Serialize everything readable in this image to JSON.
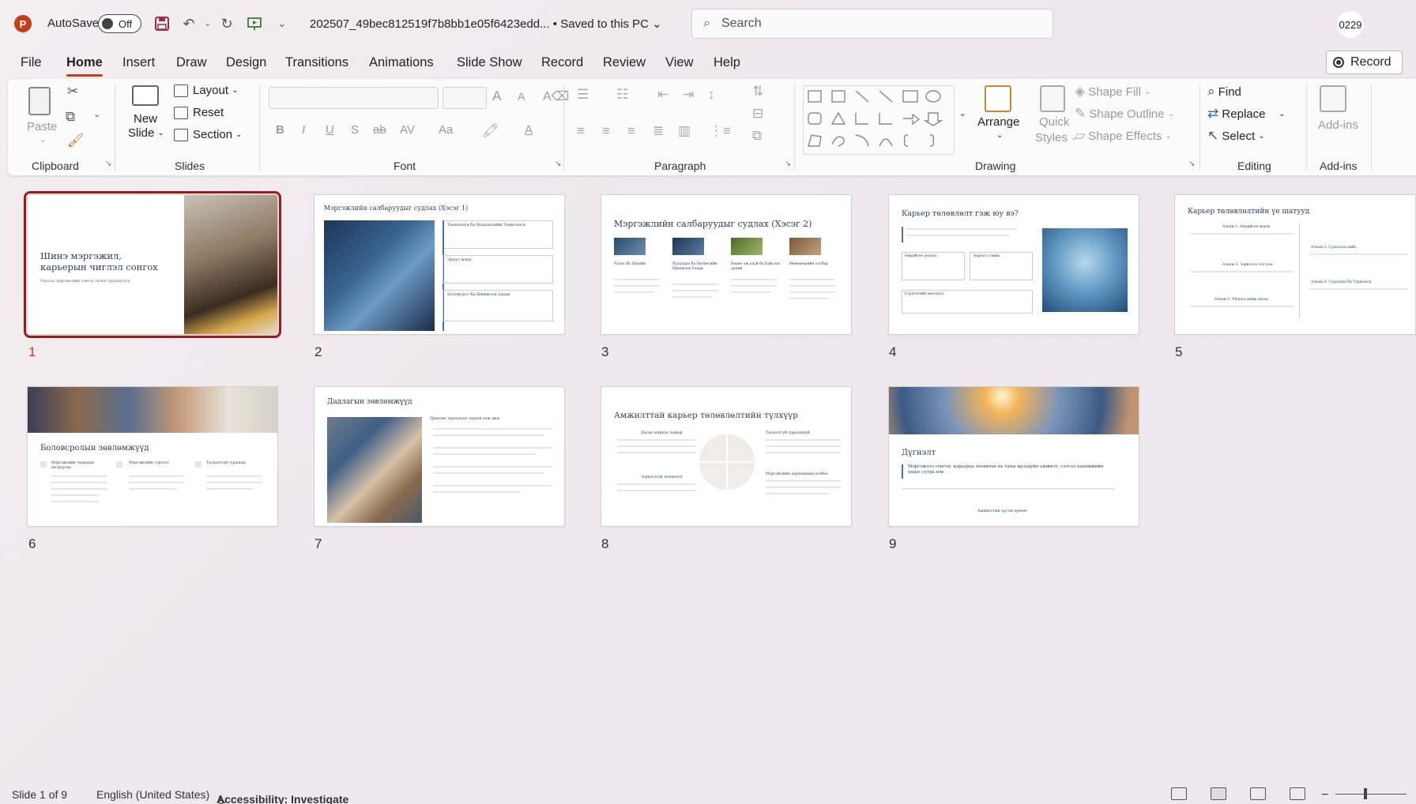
{
  "titlebar": {
    "autosave_label": "AutoSave",
    "autosave_state": "Off",
    "document_title": "202507_49bec812519f7b8bb1e05f6423edd...",
    "save_status": "Saved to this PC",
    "search_placeholder": "Search",
    "user_initials": "0229"
  },
  "menu": {
    "tabs": [
      "File",
      "Home",
      "Insert",
      "Draw",
      "Design",
      "Transitions",
      "Animations",
      "Slide Show",
      "Record",
      "Review",
      "View",
      "Help"
    ],
    "active_tab": "Home",
    "record_button": "Record"
  },
  "ribbon": {
    "clipboard": {
      "label": "Clipboard",
      "paste": "Paste"
    },
    "slides": {
      "label": "Slides",
      "new_slide_line1": "New",
      "new_slide_line2": "Slide",
      "layout": "Layout",
      "reset": "Reset",
      "section": "Section"
    },
    "font": {
      "label": "Font",
      "bold": "B",
      "italic": "I",
      "underline": "U",
      "shadow": "S",
      "strike": "ab",
      "spacing": "AV",
      "case": "Aa",
      "grow": "A",
      "shrink": "A"
    },
    "paragraph": {
      "label": "Paragraph"
    },
    "drawing": {
      "label": "Drawing",
      "arrange": "Arrange",
      "quick_styles_line1": "Quick",
      "quick_styles_line2": "Styles",
      "shape_fill": "Shape Fill",
      "shape_outline": "Shape Outline",
      "shape_effects": "Shape Effects"
    },
    "editing": {
      "label": "Editing",
      "find": "Find",
      "replace": "Replace",
      "select": "Select"
    },
    "addins": {
      "label": "Add-ins",
      "button": "Add-ins"
    }
  },
  "slides": [
    {
      "number": "1",
      "title": "Шинэ мэргэжил, карьерын чиглэл сонгох",
      "subtitle": "Ухаалаг мэргэжлийн сонгох талын туршлагууд"
    },
    {
      "number": "2",
      "title": "Мэргэжлийн салбаруудыг судлах (Хэсэг 1)",
      "items": [
        "Технологи ба Мэдээллийн Технологи",
        "Эрүүл мэнд",
        "Боловсрол ба Шинжлэх ухаан"
      ]
    },
    {
      "number": "3",
      "title": "Мэргэжлийн салбаруудыг судлах (Хэсэг 2)",
      "columns": [
        "Урлаг ба Дизайн",
        "Худалдаа ба Бизнесийн Шинжлэх Ухаан",
        "Хөдөө аж ахуй ба Байгаль орчин",
        "Инженерийн салбар"
      ]
    },
    {
      "number": "4",
      "title": "Карьер төлөвлөлт гэж юу вэ?",
      "boxes": [
        "Өөрийгөө үнэлэх",
        "Зорилго тавих",
        "Стратегийн методол"
      ]
    },
    {
      "number": "5",
      "title": "Карьер төлөвлөлтийн үе шатууд",
      "steps": [
        "Алхам 1: Өөрийгөө мэдэх",
        "Алхам 2: Судалгаа хийх",
        "Алхам 3: Зорилгоо тогтоох",
        "Алхам 4: Суралцах ба Туршлага",
        "Алхам 5: Үйлдэл хийж эхлэх"
      ]
    },
    {
      "number": "6",
      "title": "Боловсролын зөвлөмжүүд",
      "columns": [
        "Мэргэжлийн чадварыг хөгжүүлэх",
        "Мэргэжлийн сургалт",
        "Тасралтгүй суралцах"
      ]
    },
    {
      "number": "7",
      "title": "Дадлагын зөвлөмжүүд",
      "heading": "Практик туршлагыг хэрхэн олж авах"
    },
    {
      "number": "8",
      "title": "Амжилттай карьер төлөвлөлтийн түлхүүр",
      "quadrants": [
        "Дасан зохицох чадвар",
        "Тасралтгүй суралцахуй",
        "Зорилготой төлөвлөлт",
        "Мэргэжлийн харилцааны холбоо"
      ]
    },
    {
      "number": "9",
      "title": "Дүгнэлт",
      "quote": "Мэргэжлээ сонгох, карьераа төлөвлөх нь таны ирээдүйн амжилт, сэтгэл ханамжийн үндэс суурь юм.",
      "footer": "Амжилтын хүсэн ерөөе!"
    }
  ],
  "statusbar": {
    "slide_info": "Slide 1 of 9",
    "language": "English (United States)",
    "accessibility": "Accessibility: Investigate"
  },
  "colors": {
    "accent": "#c43e1c",
    "selection": "#9b1c1f",
    "slide_title": "#2e3d5a"
  }
}
